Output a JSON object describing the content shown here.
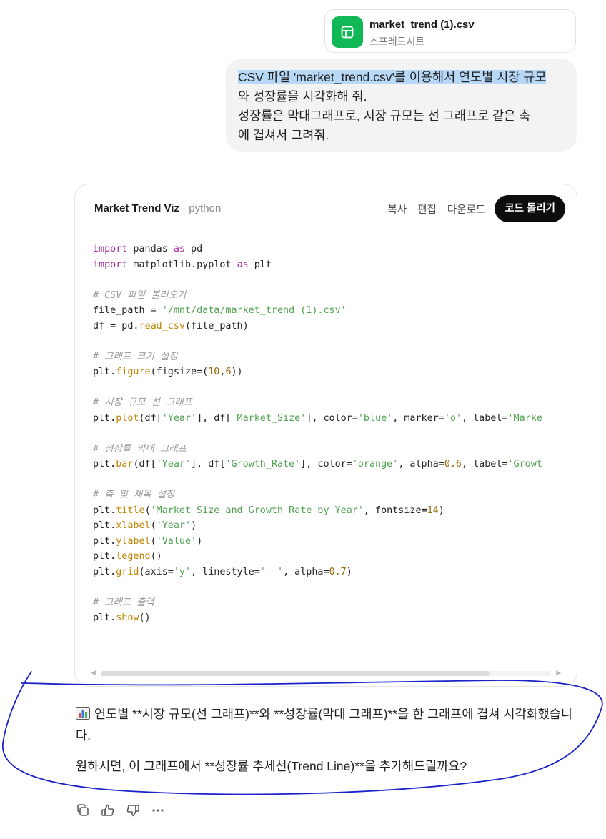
{
  "attachment": {
    "filename": "market_trend (1).csv",
    "filetype": "스프레드시트",
    "icon": "spreadsheet-icon",
    "icon_color": "#10b955"
  },
  "user_message": {
    "highlighted": "CSV 파일 'market_trend.csv'를 이용해서 연도별 시장 규모",
    "line2": "와 성장률을 시각화해 줘.",
    "line3": "성장률은 막대그래프로, 시장 규모는 선 그래프로 같은 축",
    "line4": "에 겹쳐서 그려줘."
  },
  "code_card": {
    "title": "Market Trend Viz",
    "language": "python",
    "copy_label": "복사",
    "edit_label": "편집",
    "download_label": "다운로드",
    "run_label": "코드 돌리기",
    "lines": [
      "import pandas as pd",
      "import matplotlib.pyplot as plt",
      "",
      "# CSV 파일 불러오기",
      "file_path = '/mnt/data/market_trend (1).csv'",
      "df = pd.read_csv(file_path)",
      "",
      "# 그래프 크기 설정",
      "plt.figure(figsize=(10,6))",
      "",
      "# 시장 규모 선 그래프",
      "plt.plot(df['Year'], df['Market_Size'], color='blue', marker='o', label='Marke",
      "",
      "# 성장률 막대 그래프",
      "plt.bar(df['Year'], df['Growth_Rate'], color='orange', alpha=0.6, label='Growt",
      "",
      "# 축 및 제목 설정",
      "plt.title('Market Size and Growth Rate by Year', fontsize=14)",
      "plt.xlabel('Year')",
      "plt.ylabel('Value')",
      "plt.legend()",
      "plt.grid(axis='y', linestyle='--', alpha=0.7)",
      "",
      "# 그래프 출력",
      "plt.show()"
    ]
  },
  "assistant_message": {
    "icon": "bar-chart-icon",
    "paragraph1": "연도별 **시장 규모(선 그래프)**와 **성장률(막대 그래프)**을 한 그래프에 겹쳐 시각화했습니다.",
    "paragraph2": "원하시면, 이 그래프에서 **성장률 추세선(Trend Line)**을 추가해드릴까요?"
  },
  "feedback_icons": [
    "copy-icon",
    "thumbs-up-icon",
    "thumbs-down-icon",
    "more-icon"
  ],
  "colors": {
    "highlight": "#b7d8f7",
    "annotation_ink": "#1a22c8",
    "run_button": "#0d0d0d"
  }
}
